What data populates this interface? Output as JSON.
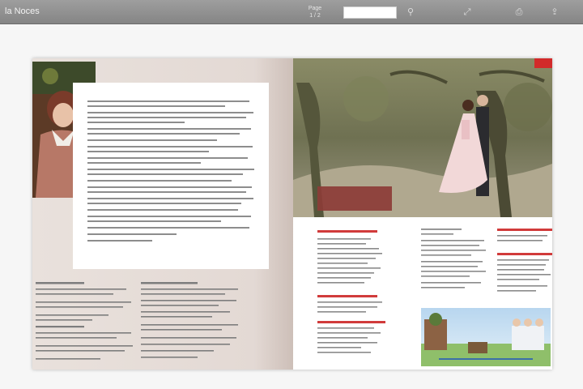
{
  "toolbar": {
    "title": "la Noces",
    "page_info": [
      "Page",
      "1 / 2"
    ],
    "search_placeholder": ""
  },
  "left_page": {
    "top_caption": [
      "",
      ""
    ],
    "body_paragraphs": [
      "",
      "",
      "",
      "",
      "",
      "",
      "",
      "",
      "",
      "",
      "",
      "",
      "",
      "",
      "",
      "",
      "",
      "",
      "",
      "",
      "",
      ""
    ],
    "footnotes": {
      "col1": {
        "heading": "",
        "lines": [
          "",
          "",
          "",
          "",
          "",
          "",
          "",
          "",
          ""
        ]
      },
      "col2": {
        "heading": "",
        "lines": [
          "",
          "",
          "",
          "",
          "",
          "",
          "",
          "",
          ""
        ]
      }
    }
  },
  "right_page": {
    "tab_label": "",
    "headline": "",
    "col1": {
      "sections": [
        {
          "heading": "",
          "lines": [
            "",
            "",
            "",
            "",
            "",
            "",
            "",
            "",
            "",
            ""
          ]
        },
        {
          "heading": "",
          "lines": [
            "",
            "",
            "",
            ""
          ]
        },
        {
          "heading": "",
          "lines": [
            "",
            "",
            "",
            "",
            "",
            ""
          ]
        }
      ]
    },
    "col2": {
      "lines": [
        "",
        "",
        "",
        "",
        "",
        "",
        "",
        "",
        "",
        "",
        "",
        ""
      ]
    },
    "col3": {
      "sections": [
        {
          "heading": "",
          "lines": [
            "",
            "",
            ""
          ]
        },
        {
          "heading": "",
          "lines": [
            "",
            "",
            "",
            "",
            ""
          ]
        }
      ]
    },
    "ad": {
      "title": "",
      "caption": ""
    }
  },
  "colors": {
    "accent_red": "#d22a2a",
    "headline_bg": "#8c3c37",
    "toolbar": "#8f8f8f"
  }
}
